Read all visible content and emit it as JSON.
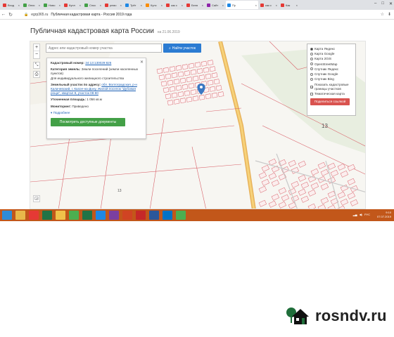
{
  "browser": {
    "tabs": [
      {
        "label": "Вход",
        "color": "#e53935",
        "active": false
      },
      {
        "label": "Опис",
        "color": "#43a047",
        "active": false
      },
      {
        "label": "Ново",
        "color": "#43a047",
        "active": false
      },
      {
        "label": "Купл",
        "color": "#e53935",
        "active": false
      },
      {
        "label": "Спос",
        "color": "#43a047",
        "active": false
      },
      {
        "label": "ремо",
        "color": "#e53935",
        "active": false
      },
      {
        "label": "Трёт",
        "color": "#1e88e5",
        "active": false
      },
      {
        "label": "Кулс",
        "color": "#fb8c00",
        "active": false
      },
      {
        "label": "как с",
        "color": "#e53935",
        "active": false
      },
      {
        "label": "Беля",
        "color": "#e53935",
        "active": false
      },
      {
        "label": "Сайт",
        "color": "#8e24aa",
        "active": false
      },
      {
        "label": "Пу",
        "color": "#1e88e5",
        "active": true
      },
      {
        "label": "как с",
        "color": "#e53935",
        "active": false
      },
      {
        "label": "Как",
        "color": "#e53935",
        "active": false
      }
    ],
    "url_host": "egrp365.ru",
    "url_title": "Публичная кадастровая карта - Россия 2019 года"
  },
  "page": {
    "title": "Публичная кадастровая карта России",
    "subtitle": "на 21.06.2019"
  },
  "search": {
    "placeholder": "Адрес или кадастровый номер участка",
    "button": "Найти участок"
  },
  "map_controls": {
    "zoom_in": "+",
    "zoom_out": "−"
  },
  "card": {
    "cadastral_label": "Кадастровый номер:",
    "cadastral_value": "34:13:130029:826",
    "category_label": "Категория земель:",
    "category_value": "Земли поселений (земли населенных пунктов)",
    "use_value": "Для индивидуального жилищного строительства",
    "address_label": "Земельный участок по адресу:",
    "address_value": "обл. Волгоградская, р-н Калачевский, г. Калач-на-Дону, Жилой поселок \"Дубовая роща\", квартал 8, участок 08-80",
    "area_label": "Уточненная площадь:",
    "area_value": "1 056 кв.м",
    "ownership_label": "Мониторинг:",
    "ownership_value": "Приведено",
    "more": "Подробнее",
    "docs_button": "Посмотреть доступные документы"
  },
  "layers": {
    "options": [
      {
        "label": "Карта Яндекс",
        "selected": true
      },
      {
        "label": "Карта Google",
        "selected": false
      },
      {
        "label": "Карта 2GIS",
        "selected": false
      },
      {
        "label": "OpenStreetMap",
        "selected": false
      },
      {
        "label": "Спутник Яндекс",
        "selected": false
      },
      {
        "label": "Спутник Google",
        "selected": false
      },
      {
        "label": "Спутник Bing",
        "selected": false
      }
    ],
    "check1": "Показать кадастровые границы участков",
    "check2": "Тематическая карта",
    "share": "Поделиться ссылкой"
  },
  "map_labels": {
    "block_num": "13",
    "parcel_num": "13"
  },
  "taskbar": {
    "apps": [
      {
        "icon": "windows-icon",
        "color": "#2e8bd6"
      },
      {
        "icon": "folder-icon",
        "color": "#e8b84a"
      },
      {
        "icon": "yandex-icon",
        "color": "#e53935"
      },
      {
        "icon": "excel-icon",
        "color": "#217346"
      },
      {
        "icon": "explorer-icon",
        "color": "#f0c24a"
      },
      {
        "icon": "chrome-icon",
        "color": "#4caf50"
      },
      {
        "icon": "excel-icon",
        "color": "#217346"
      },
      {
        "icon": "ie-icon",
        "color": "#1e88e5"
      },
      {
        "icon": "onenote-icon",
        "color": "#7b3fa0"
      },
      {
        "icon": "powerpoint-icon",
        "color": "#d04423"
      },
      {
        "icon": "acrobat-icon",
        "color": "#c62828"
      },
      {
        "icon": "word-icon",
        "color": "#2b579a"
      },
      {
        "icon": "outlook-icon",
        "color": "#0072c6"
      },
      {
        "icon": "chrome-icon",
        "color": "#4caf50"
      }
    ],
    "lang": "РУС",
    "time": "9:10",
    "date": "07.07.2019"
  },
  "watermark": {
    "text": "rosndv.ru",
    "icon": "house-tree-icon"
  }
}
